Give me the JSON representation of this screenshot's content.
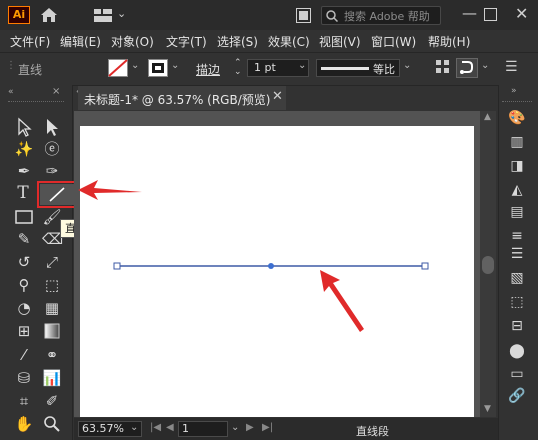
{
  "app": {
    "logo_text": "Ai"
  },
  "search": {
    "placeholder": "搜索 Adobe 帮助"
  },
  "menu": [
    "文件(F)",
    "编辑(E)",
    "对象(O)",
    "文字(T)",
    "选择(S)",
    "效果(C)",
    "视图(V)",
    "窗口(W)",
    "帮助(H)"
  ],
  "control": {
    "tool_name": "直线",
    "stroke_label": "描边",
    "stroke_weight": "1 pt",
    "profile_label": "等比"
  },
  "document": {
    "tab_label": "未标题-1* @ 63.57% (RGB/预览)"
  },
  "tooltip": {
    "text": "直线段工具 (\\)"
  },
  "status": {
    "zoom": "63.57%",
    "page": "1",
    "tool": "直线段"
  },
  "colors": {
    "accent_red": "#e02a2a",
    "path_blue": "#3d5aa6",
    "artboard": "#ffffff"
  },
  "icons": [
    "home-icon",
    "workspace-icon",
    "arrange-icon",
    "search-icon",
    "minimize-icon",
    "maximize-icon",
    "close-icon"
  ]
}
